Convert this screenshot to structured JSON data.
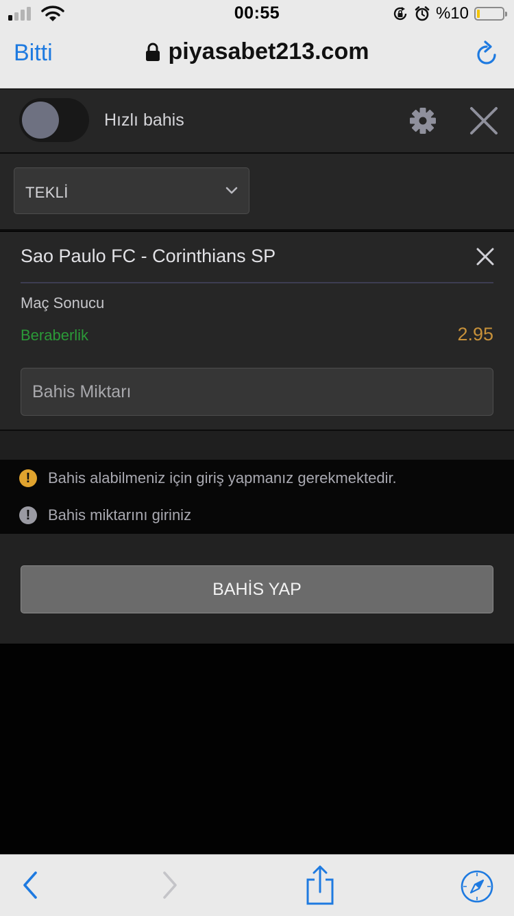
{
  "status_bar": {
    "time": "00:55",
    "battery_percent_label": "%10",
    "battery_level": 0.1,
    "signal_bars_active": 1,
    "signal_bars_total": 4
  },
  "browser": {
    "done_label": "Bitti",
    "url": "piyasabet213.com"
  },
  "bet_slip": {
    "quick_bet_label": "Hızlı bahis",
    "quick_bet_enabled": false,
    "bet_type_selected": "TEKLİ",
    "selection": {
      "match": "Sao Paulo FC - Corinthians SP",
      "market": "Maç Sonucu",
      "outcome": "Beraberlik",
      "odds": "2.95"
    },
    "stake_placeholder": "Bahis Miktarı",
    "warnings": [
      {
        "text": "Bahis alabilmeniz için giriş yapmanız gerekmektedir.",
        "icon": "warning-icon",
        "color": "#e0a32e"
      },
      {
        "text": "Bahis miktarını giriniz",
        "icon": "info-icon",
        "color": "#9a9aa2"
      }
    ],
    "place_bet_label": "BAHİS YAP"
  },
  "colors": {
    "accent_blue": "#1e7ae0",
    "outcome_green": "#2b9a38",
    "odds_gold": "#c7913a"
  },
  "icons": {
    "toolbar": [
      "back-icon",
      "forward-icon",
      "share-icon",
      "compass-icon"
    ]
  }
}
